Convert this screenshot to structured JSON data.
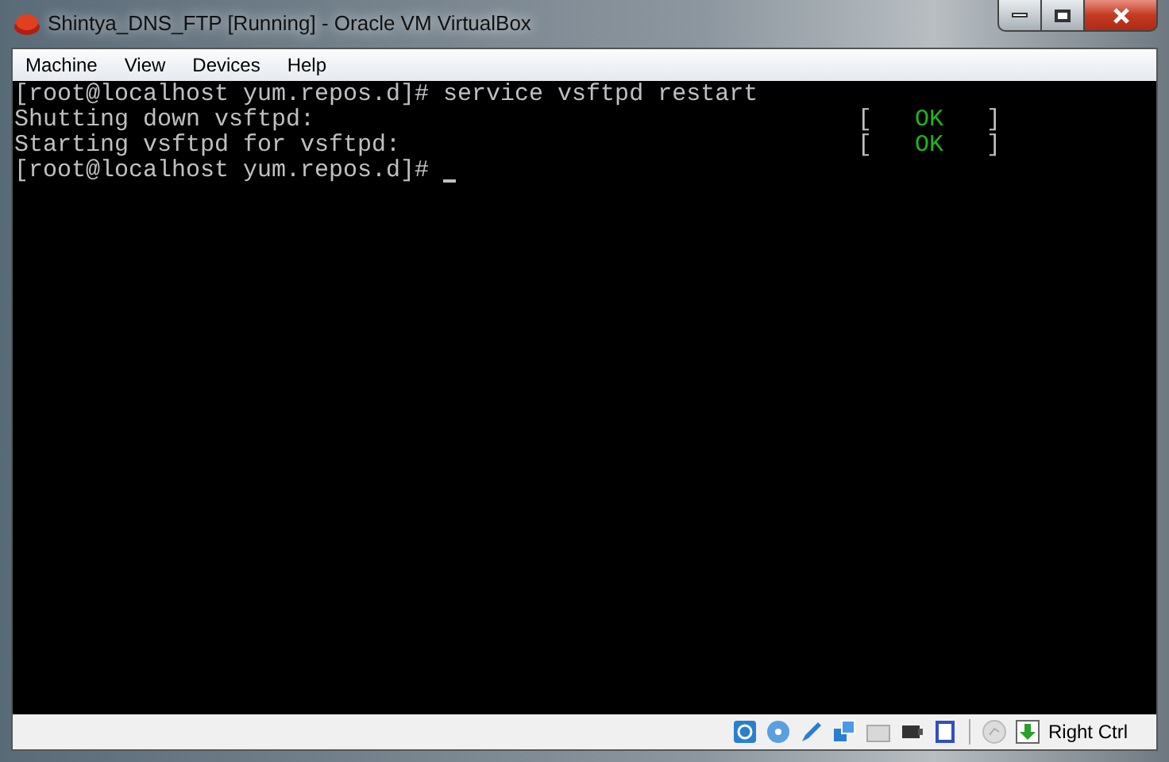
{
  "window": {
    "title": "Shintya_DNS_FTP [Running] - Oracle VM VirtualBox"
  },
  "menu": [
    "Machine",
    "View",
    "Devices",
    "Help"
  ],
  "terminal": {
    "lines": [
      {
        "kind": "plain",
        "text": "[root@localhost yum.repos.d]# service vsftpd restart"
      },
      {
        "kind": "status",
        "text": "Shutting down vsftpd:",
        "open": "[",
        "status": "OK",
        "close": "]"
      },
      {
        "kind": "status",
        "text": "Starting vsftpd for vsftpd:",
        "open": "[",
        "status": "OK",
        "close": "]"
      },
      {
        "kind": "prompt",
        "text": "[root@localhost yum.repos.d]#",
        "cursor": true
      }
    ]
  },
  "status_bar": {
    "host_key": "Right Ctrl"
  }
}
